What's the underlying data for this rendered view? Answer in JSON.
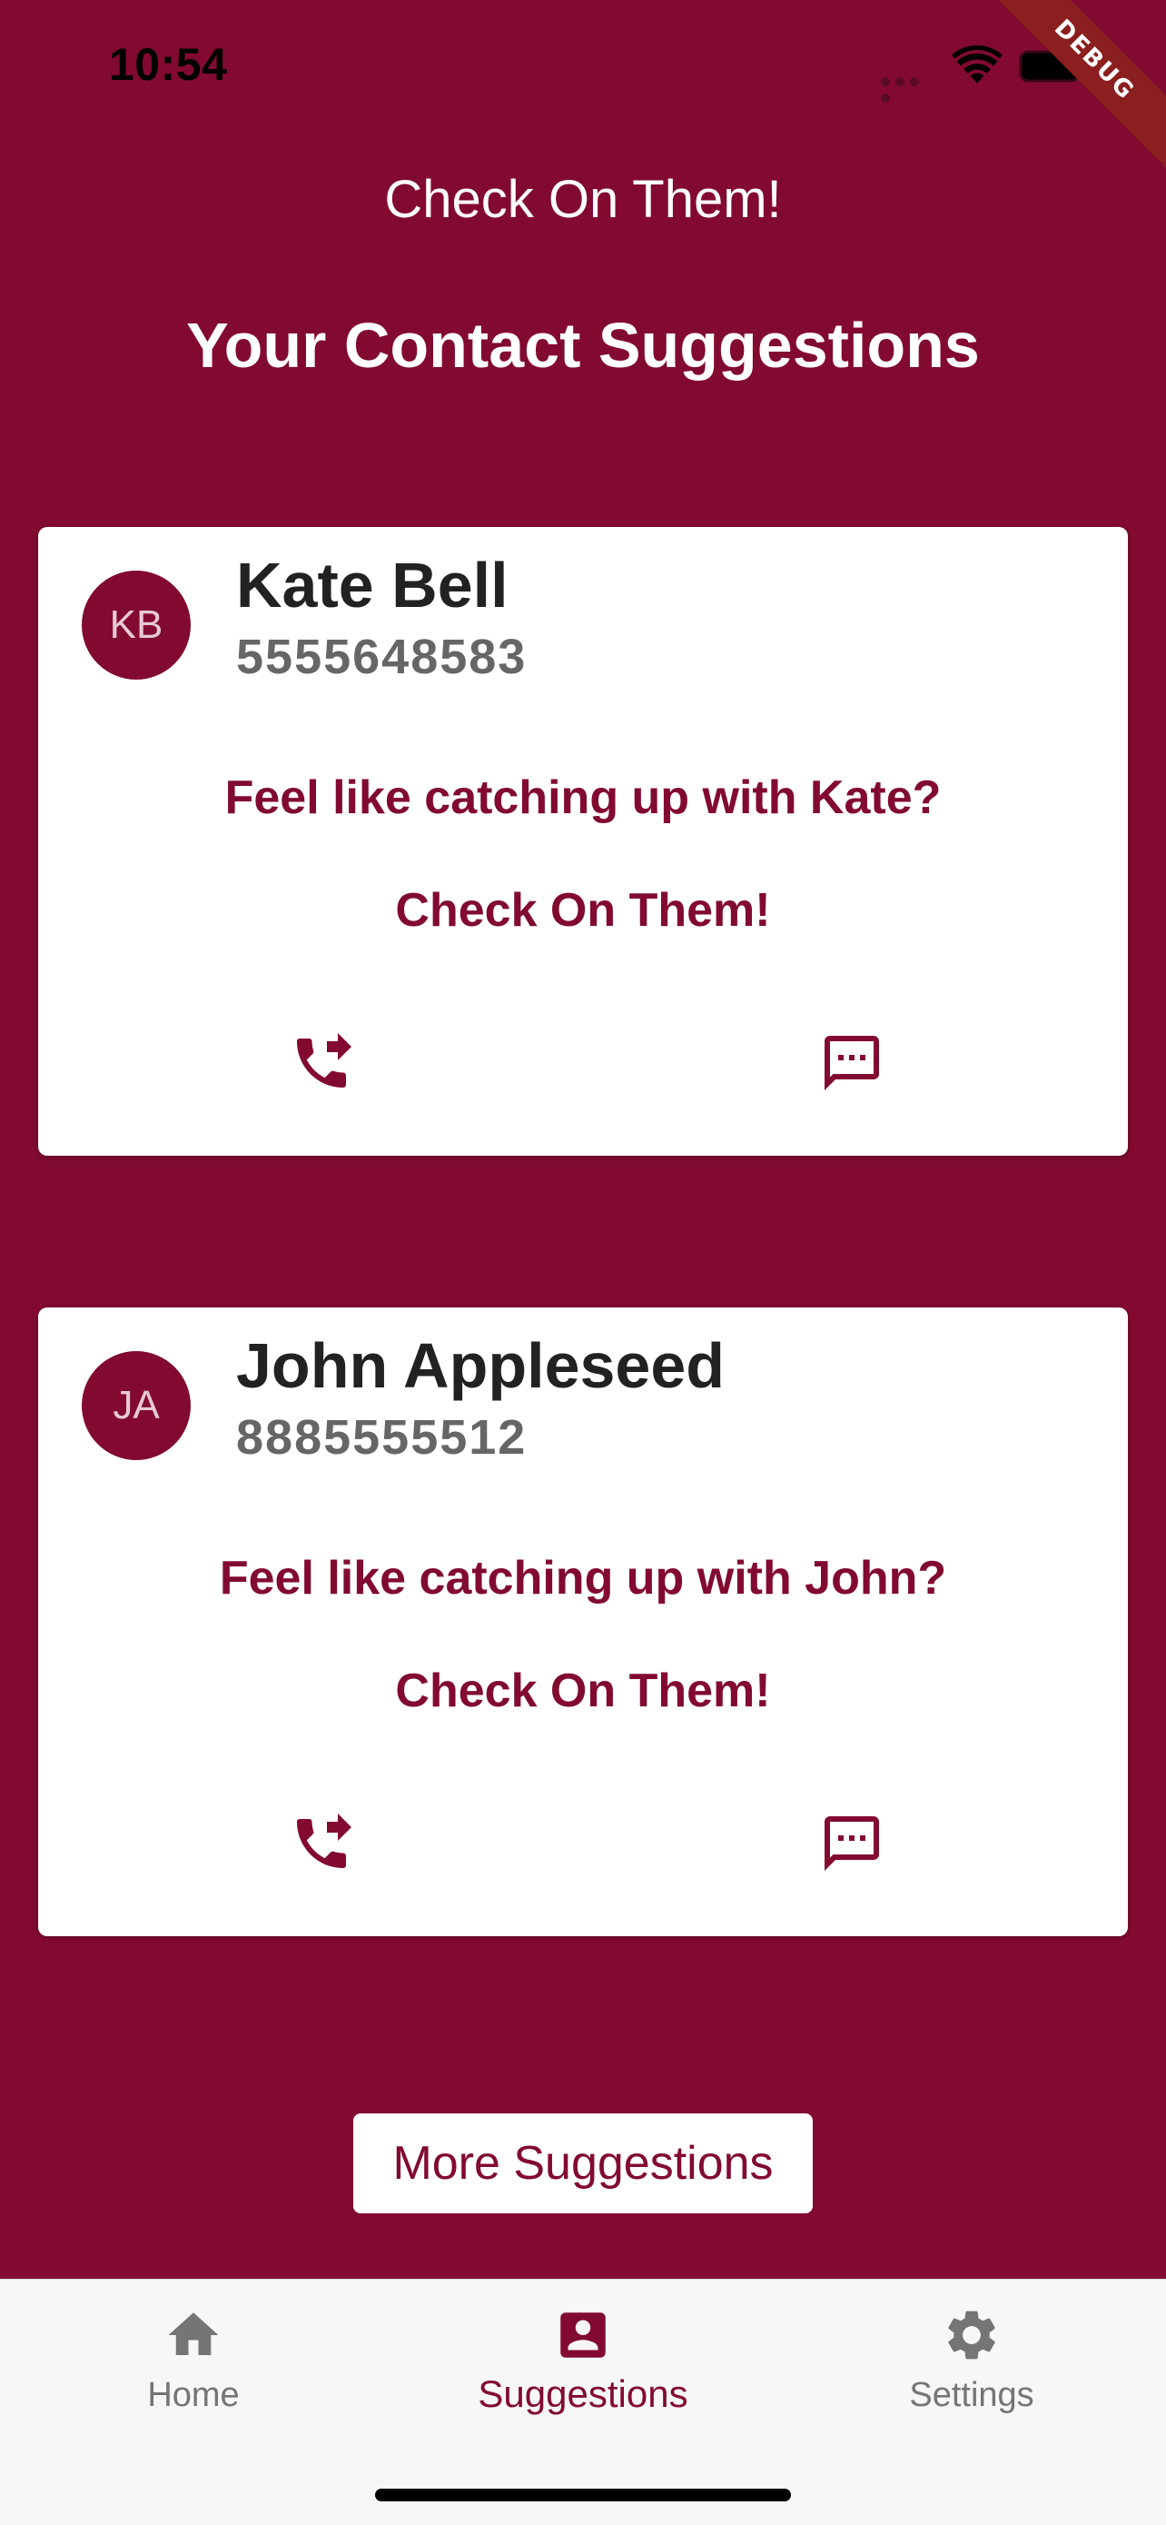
{
  "status_bar": {
    "time": "10:54"
  },
  "debug_banner": "DEBUG",
  "app_title": "Check On Them!",
  "page_title": "Your Contact Suggestions",
  "contacts": [
    {
      "initials": "KB",
      "name": "Kate Bell",
      "phone": "5555648583",
      "prompt": "Feel like catching up with Kate?",
      "action_label": "Check On Them!",
      "call_icon": "phone-forwarded-icon",
      "message_icon": "sms-icon"
    },
    {
      "initials": "JA",
      "name": "John Appleseed",
      "phone": "8885555512",
      "prompt": "Feel like catching up with John?",
      "action_label": "Check On Them!",
      "call_icon": "phone-forwarded-icon",
      "message_icon": "sms-icon"
    }
  ],
  "more_button_label": "More Suggestions",
  "nav": {
    "items": [
      {
        "label": "Home",
        "icon": "home-icon",
        "active": false
      },
      {
        "label": "Suggestions",
        "icon": "contact-card-icon",
        "active": true
      },
      {
        "label": "Settings",
        "icon": "gear-icon",
        "active": false
      }
    ]
  },
  "colors": {
    "primary": "#820A31",
    "card": "#FFFFFF",
    "nav_background": "#F7F7F7",
    "nav_inactive": "#757575"
  }
}
